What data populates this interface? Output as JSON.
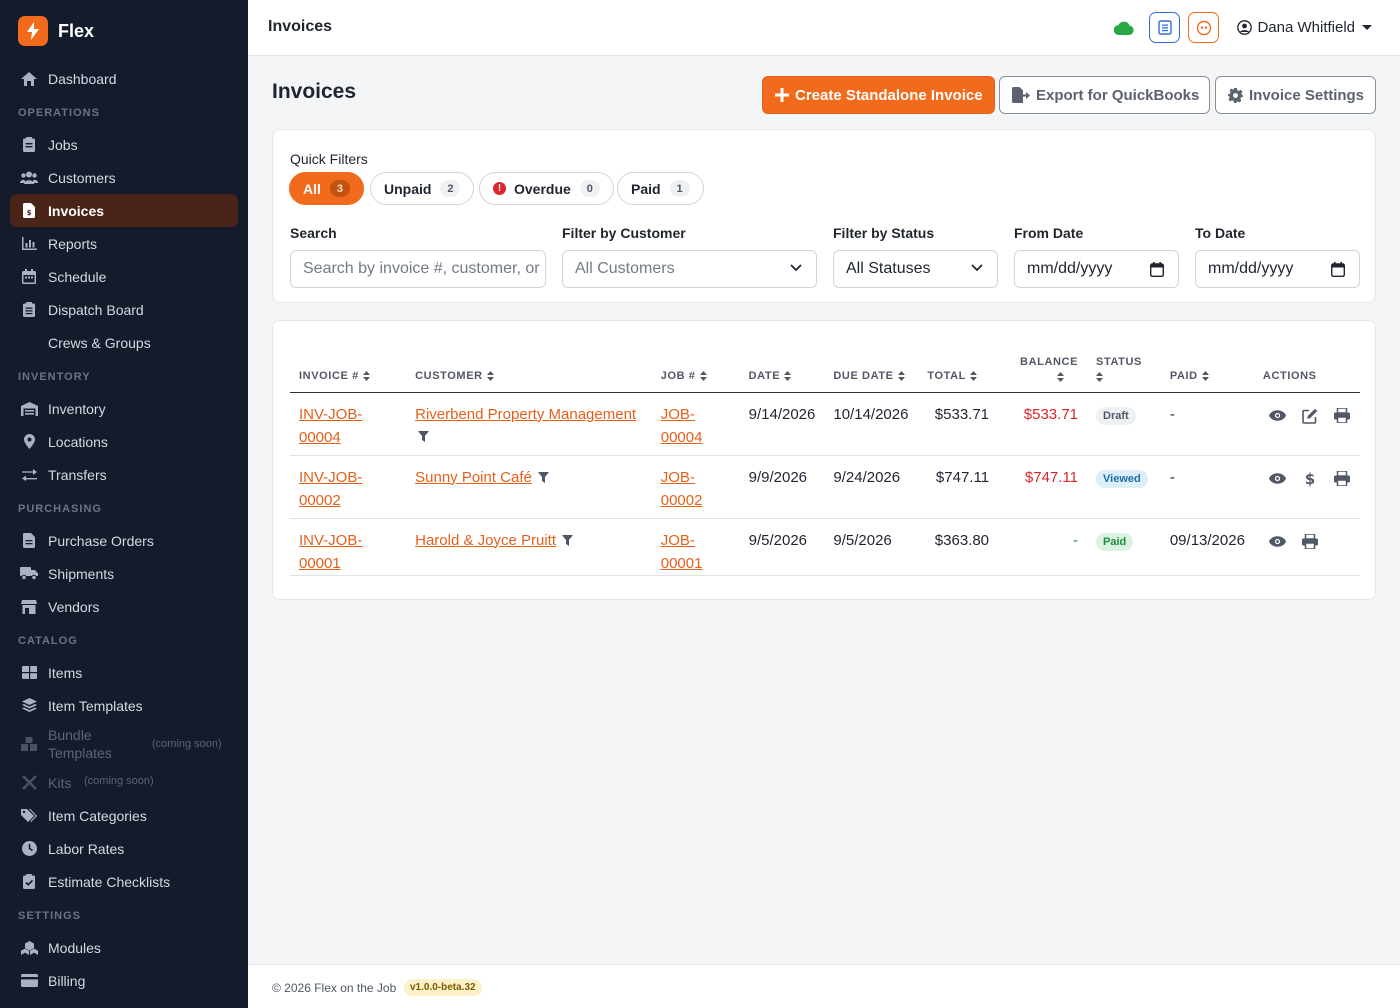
{
  "brand": {
    "name": "Flex"
  },
  "sidebar": {
    "dashboard": "Dashboard",
    "sections": {
      "operations": "OPERATIONS",
      "inventory": "INVENTORY",
      "purchasing": "PURCHASING",
      "catalog": "CATALOG",
      "settings": "SETTINGS"
    },
    "operations": [
      "Jobs",
      "Customers",
      "Invoices",
      "Reports",
      "Schedule",
      "Dispatch Board",
      "Crews & Groups"
    ],
    "inventory": [
      "Inventory",
      "Locations",
      "Transfers"
    ],
    "purchasing": [
      "Purchase Orders",
      "Shipments",
      "Vendors"
    ],
    "catalog": [
      "Items",
      "Item Templates",
      "Bundle Templates",
      "Kits",
      "Item Categories",
      "Labor Rates",
      "Estimate Checklists"
    ],
    "coming_soon": "(coming soon)",
    "settings": [
      "Modules",
      "Billing"
    ],
    "active_item": "Invoices"
  },
  "topbar": {
    "title": "Invoices",
    "user_name": "Dana Whitfield"
  },
  "page": {
    "title": "Invoices",
    "create_button": "Create Standalone Invoice",
    "export_button": "Export for QuickBooks",
    "settings_button": "Invoice Settings"
  },
  "filters": {
    "quick_label": "Quick Filters",
    "pills": [
      {
        "label": "All",
        "count": "3"
      },
      {
        "label": "Unpaid",
        "count": "2"
      },
      {
        "label": "Overdue",
        "count": "0"
      },
      {
        "label": "Paid",
        "count": "1"
      }
    ],
    "search_label": "Search",
    "search_placeholder": "Search by invoice #, customer, or",
    "customer_label": "Filter by Customer",
    "customer_value": "All Customers",
    "status_label": "Filter by Status",
    "status_value": "All Statuses",
    "from_label": "From Date",
    "from_value": "mm/dd/yyyy",
    "to_label": "To Date",
    "to_value": "mm/dd/yyyy"
  },
  "table": {
    "headers": {
      "invoice": "INVOICE #",
      "customer": "CUSTOMER",
      "job": "JOB #",
      "date": "DATE",
      "due": "DUE DATE",
      "total": "TOTAL",
      "balance": "BALANCE",
      "status": "STATUS",
      "paid": "PAID",
      "actions": "ACTIONS"
    },
    "rows": [
      {
        "invoice_line1": "INV-JOB-",
        "invoice_line2": "00004",
        "customer": "Riverbend Property Management",
        "job_line1": "JOB-",
        "job_line2": "00004",
        "date": "9/14/2026",
        "due": "10/14/2026",
        "total": "$533.71",
        "balance": "$533.71",
        "status": "Draft",
        "paid": "-"
      },
      {
        "invoice_line1": "INV-JOB-",
        "invoice_line2": "00002",
        "customer": "Sunny Point Café",
        "job_line1": "JOB-",
        "job_line2": "00002",
        "date": "9/9/2026",
        "due": "9/24/2026",
        "total": "$747.11",
        "balance": "$747.11",
        "status": "Viewed",
        "paid": "-"
      },
      {
        "invoice": "INV-JOB-00001",
        "customer": "Harold & Joyce Pruitt",
        "job": "JOB-00001",
        "date": "9/5/2026",
        "due": "9/5/2026",
        "total": "$363.80",
        "balance": "-",
        "status": "Paid",
        "paid": "09/13/2026"
      }
    ]
  },
  "footer": {
    "copyright": "© 2026 Flex on the Job",
    "version": "v1.0.0-beta.32"
  },
  "colors": {
    "accent": "#f26a1b",
    "sidebar_bg": "#141b2a",
    "danger": "#d9262c"
  }
}
